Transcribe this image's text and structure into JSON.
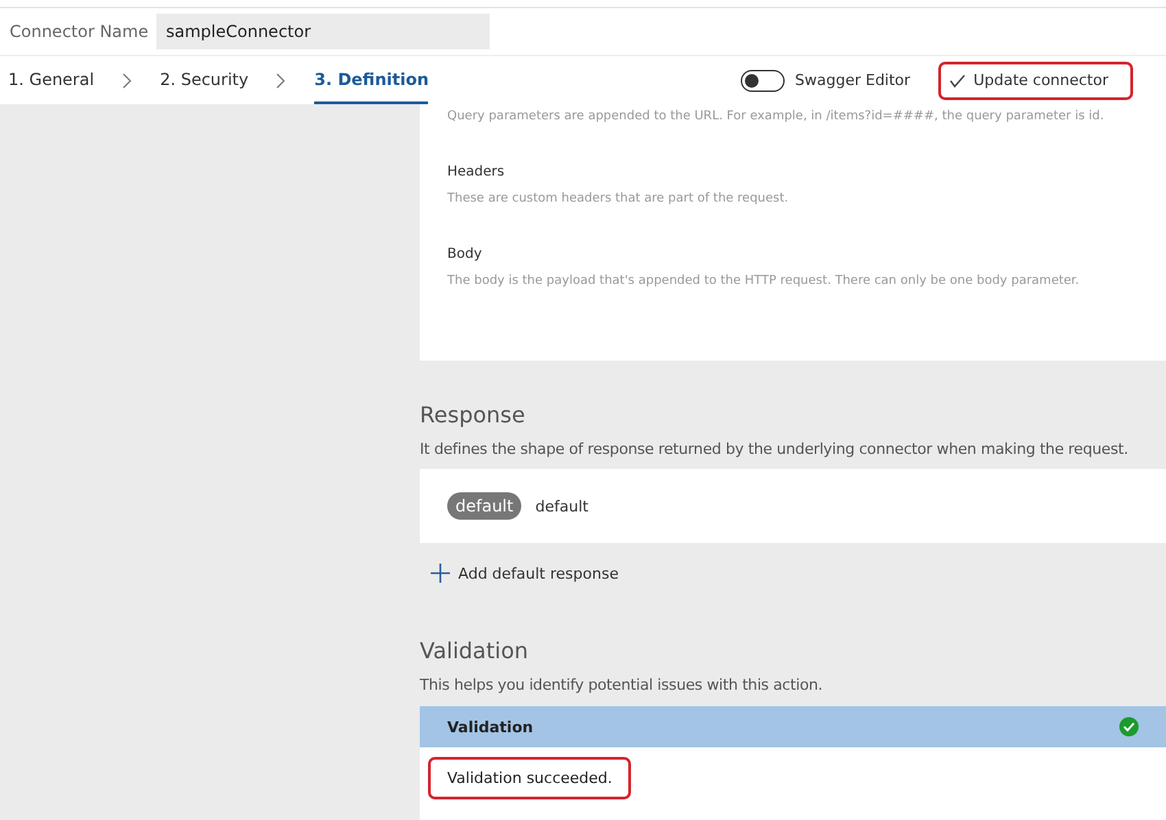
{
  "connector_name": {
    "label": "Connector Name",
    "value": "sampleConnector"
  },
  "steps": [
    {
      "label": "1. General",
      "selected": false
    },
    {
      "label": "2. Security",
      "selected": false
    },
    {
      "label": "3. Definition",
      "selected": true
    }
  ],
  "swagger_editor": {
    "label": "Swagger Editor",
    "on": false
  },
  "update_button": {
    "label": "Update connector",
    "highlighted": true
  },
  "request_params": [
    {
      "description": "Query parameters are appended to the URL. For example, in /items?id=####, the query parameter is id."
    },
    {
      "title": "Headers",
      "description": "These are custom headers that are part of the request."
    },
    {
      "title": "Body",
      "description": "The body is the payload that's appended to the HTTP request. There can only be one body parameter."
    }
  ],
  "response": {
    "title": "Response",
    "description": "It defines the shape of response returned by the underlying connector when making the request.",
    "items": [
      {
        "badge": "default",
        "label": "default"
      }
    ],
    "add_label": "Add default response"
  },
  "validation": {
    "title": "Validation",
    "description": "This helps you identify potential issues with this action.",
    "header": "Validation",
    "succeeded": true,
    "message": "Validation succeeded.",
    "highlighted": true
  }
}
